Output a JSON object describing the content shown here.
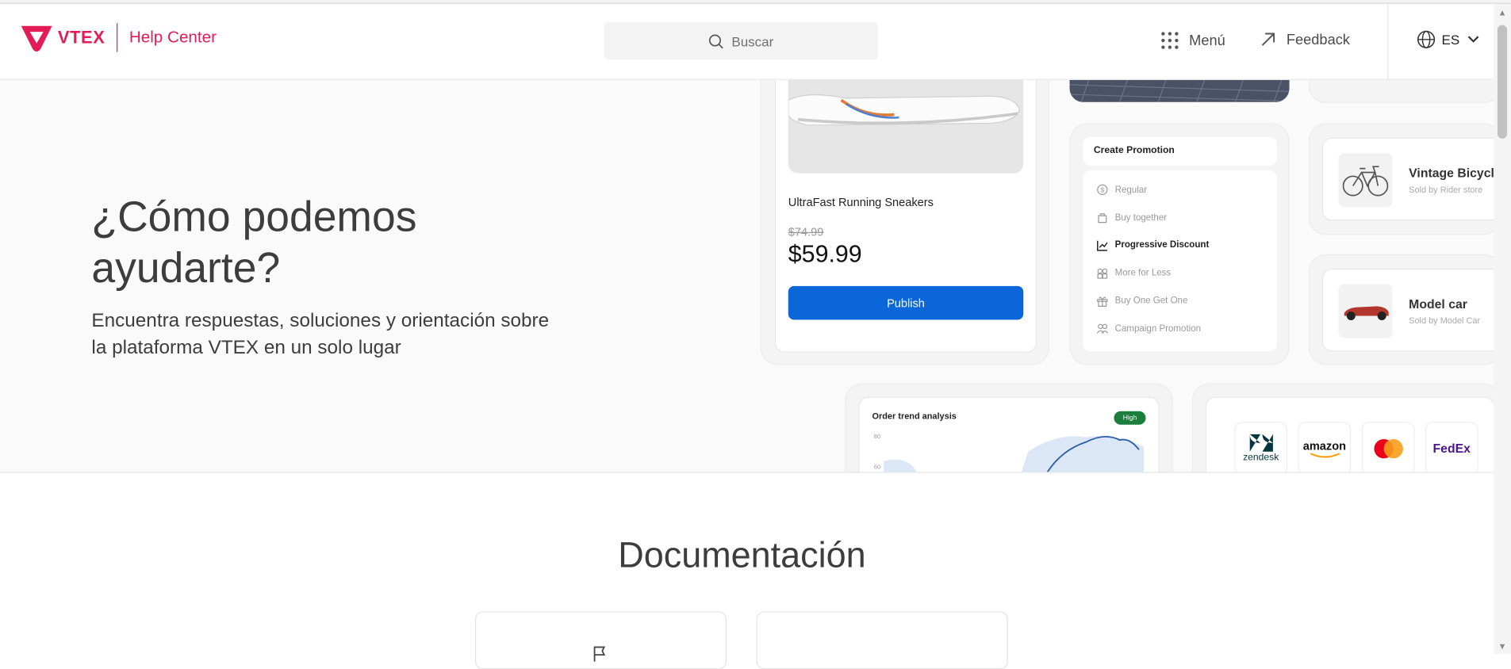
{
  "header": {
    "brand": "VTEX",
    "product": "Help Center",
    "search_placeholder": "Buscar",
    "menu_label": "Menú",
    "feedback_label": "Feedback",
    "language": "ES"
  },
  "hero": {
    "title": "¿Cómo podemos ayudarte?",
    "subtitle": "Encuentra respuestas, soluciones y orientación sobre la plataforma VTEX en un solo lugar"
  },
  "showcase": {
    "product": {
      "name": "UltraFast Running Sneakers",
      "old_price": "$74.99",
      "price": "$59.99",
      "button": "Publish"
    },
    "promotion": {
      "title": "Create Promotion",
      "items": [
        {
          "label": "Regular",
          "icon": "dollar-circle-icon"
        },
        {
          "label": "Buy together",
          "icon": "bag-icon"
        },
        {
          "label": "Progressive Discount",
          "icon": "trend-icon"
        },
        {
          "label": "More for Less",
          "icon": "grid-icon"
        },
        {
          "label": "Buy One Get One",
          "icon": "gift-icon"
        },
        {
          "label": "Campaign Promotion",
          "icon": "users-icon"
        }
      ],
      "active_index": 2
    },
    "products": [
      {
        "title": "Vintage Bicycl",
        "seller": "Sold by Rider store"
      },
      {
        "title": "Model car",
        "seller": "Sold by Model Car"
      }
    ],
    "chart": {
      "title": "Order trend analysis",
      "badge": "High",
      "tick_top": "80",
      "tick_mid": "60"
    },
    "brands": [
      "zendesk",
      "amazon",
      "mastercard",
      "FedEx"
    ]
  },
  "docs": {
    "title": "Documentación"
  },
  "colors": {
    "brand": "#e31c58",
    "button": "#0a66d9",
    "badge": "#1a7f3c"
  }
}
